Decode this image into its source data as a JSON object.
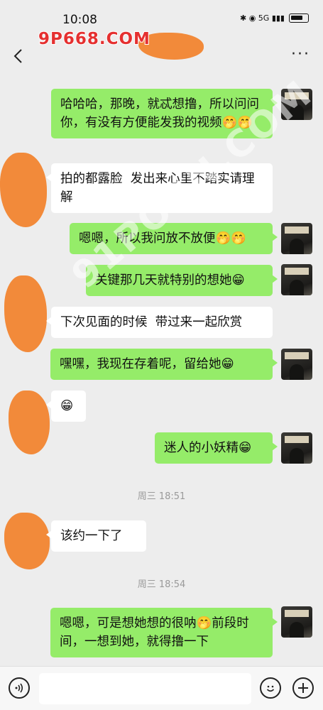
{
  "status": {
    "time": "10:08",
    "icons_text": "✱ ◉ 5G ▮▮▮"
  },
  "watermark": {
    "top_text": "9P668.COM",
    "diag_text": "91PORN.COM"
  },
  "nav": {
    "back_icon": "chevron-left-icon",
    "more_label": "···"
  },
  "messages": [
    {
      "side": "me",
      "text": "哈哈哈，那晚，就忒想撸，所以问问你，有没有方便能发我的视频🤭🤭"
    },
    {
      "side": "them",
      "text": "拍的都露脸  发出来心里不踏实请理解"
    },
    {
      "side": "me",
      "text": "嗯嗯，所以我问放不放便🤭🤭"
    },
    {
      "side": "me",
      "text": "关键那几天就特别的想她😁"
    },
    {
      "side": "them",
      "text": "下次见面的时候  带过来一起欣赏"
    },
    {
      "side": "me",
      "text": "嘿嘿，我现在存着呢，留给她😁"
    },
    {
      "side": "them",
      "text": "😁"
    },
    {
      "side": "me",
      "text": "迷人的小妖精😁"
    },
    {
      "side": "time",
      "text": "周三 18:51"
    },
    {
      "side": "them",
      "text": "该约一下了"
    },
    {
      "side": "time",
      "text": "周三 18:54"
    },
    {
      "side": "me",
      "text": "嗯嗯，可是想她想的很呐🤭前段时间，一想到她，就得撸一下"
    }
  ],
  "input": {
    "placeholder": "",
    "voice_icon": "voice-icon",
    "emoji_icon": "emoji-icon",
    "plus_icon": "plus-icon"
  },
  "colors": {
    "me_bubble": "#95ec69",
    "them_bubble": "#ffffff",
    "background": "#ededed",
    "redaction": "#f28a3a"
  }
}
